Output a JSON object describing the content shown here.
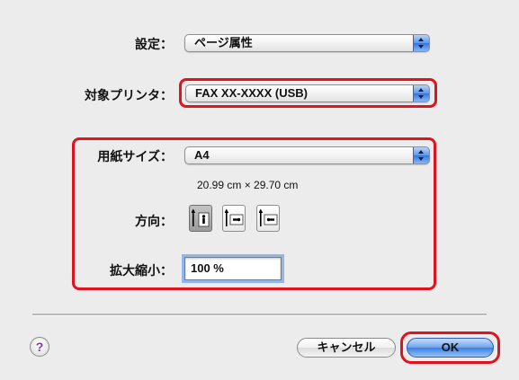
{
  "settings": {
    "label": "設定：",
    "value": "ページ属性"
  },
  "printer": {
    "label": "対象プリンタ：",
    "value": "FAX XX-XXXX (USB)"
  },
  "paper": {
    "size_label": "用紙サイズ：",
    "size_value": "A4",
    "dimensions": "20.99 cm × 29.70 cm"
  },
  "orientation": {
    "label": "方向：",
    "options": [
      "portrait",
      "landscape-left",
      "landscape-right"
    ],
    "selected": "portrait"
  },
  "scale": {
    "label": "拡大縮小：",
    "value": "100 %"
  },
  "buttons": {
    "help": "?",
    "cancel": "キャンセル",
    "ok": "OK"
  },
  "colors": {
    "highlight": "#e0141e",
    "accent": "#3b7fe2",
    "background": "#ececec"
  }
}
